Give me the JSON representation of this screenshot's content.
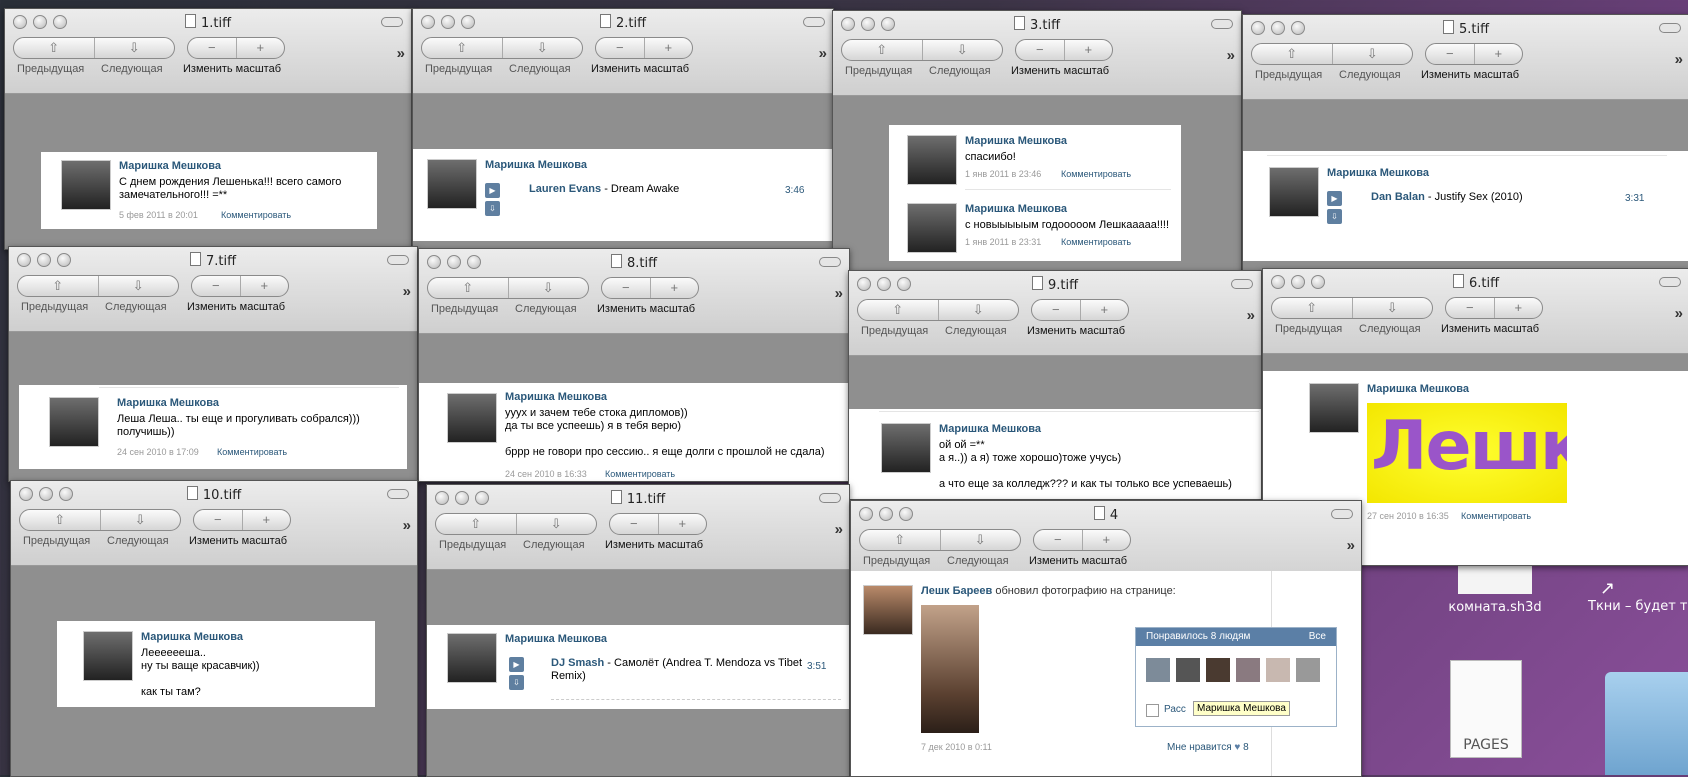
{
  "toolbar": {
    "prev": "Предыдущая",
    "next": "Следующая",
    "zoom": "Изменить масштаб"
  },
  "desktop": {
    "file1": "комната.sh3d",
    "file2": "Ткни – будет т",
    "pages": "PAGES"
  },
  "windows": {
    "w1": {
      "title": "1.tiff",
      "name": "Маришка Мешкова",
      "msg": "С днем рождения Лешенька!!! всего самого\nзамечательного!!! =**",
      "date": "5 фев 2011 в 20:01",
      "comment": "Комментировать"
    },
    "w2": {
      "title": "2.tiff",
      "name": "Маришка Мешкова",
      "artist": "Lauren Evans",
      "song": " - Dream Awake",
      "dur": "3:46"
    },
    "w3": {
      "title": "3.tiff",
      "name": "Маришка Мешкова",
      "msg": "спасиибо!",
      "date": "1 янв 2011 в 23:46",
      "comment": "Комментировать",
      "name2": "Маришка Мешкова",
      "msg2": "с новыыыыым годооооом Лешкааааа!!!!",
      "date2": "1 янв 2011 в 23:31",
      "comment2": "Комментировать"
    },
    "w5": {
      "title": "5.tiff",
      "name": "Маришка Мешкова",
      "artist": "Dan Balan",
      "song": " - Justify Sex (2010)",
      "dur": "3:31"
    },
    "w7": {
      "title": "7.tiff",
      "name": "Маришка Мешкова",
      "msg": "Леша Леша.. ты еще и прогуливать собрался)))\nполучишь))",
      "date": "24 сен 2010 в 17:09",
      "comment": "Комментировать"
    },
    "w8": {
      "title": "8.tiff",
      "name": "Маришка Мешкова",
      "msg": "уууx и зачем тебе стока дипломов))\nда ты все успеешь) я в тебя верю)\n\nбррр не говори про сессию.. я еще долги с прошлой не сдала)",
      "date": "24 сен 2010 в 16:33",
      "comment": "Комментировать"
    },
    "w9": {
      "title": "9.tiff",
      "name": "Маришка Мешкова",
      "msg": "ой ой =**\nа я..)) а я) тоже хорошо)тоже учусь)\n\nа что еще за колледж??? и как ты только все успеваешь)"
    },
    "w6": {
      "title": "6.tiff",
      "name": "Маришка Мешкова",
      "drawing": "Лешк",
      "date": "27 сен 2010 в 16:35",
      "comment": "Комментировать"
    },
    "w10": {
      "title": "10.tiff",
      "name": "Маришка Мешкова",
      "msg": "Лееееееша..\nну ты ваще красавчик))\n\nкак ты там?"
    },
    "w11": {
      "title": "11.tiff",
      "name": "Маришка Мешкова",
      "artist": "DJ Smash",
      "song": " - Самолёт (Andrea T. Mendoza vs Tibet\nRemix)",
      "dur": "3:51"
    },
    "w4": {
      "title": "4",
      "author": "Лешк Бареев",
      "action": " обновил фотографию на странице:",
      "liked": "Понравилось 8 людям",
      "all": "Все",
      "tell": "Расс",
      "tooltip": "Маришка Мешкова",
      "date": "7 дек 2010 в 0:11",
      "likelabel": "Мне нравится",
      "likecount": "8"
    }
  }
}
